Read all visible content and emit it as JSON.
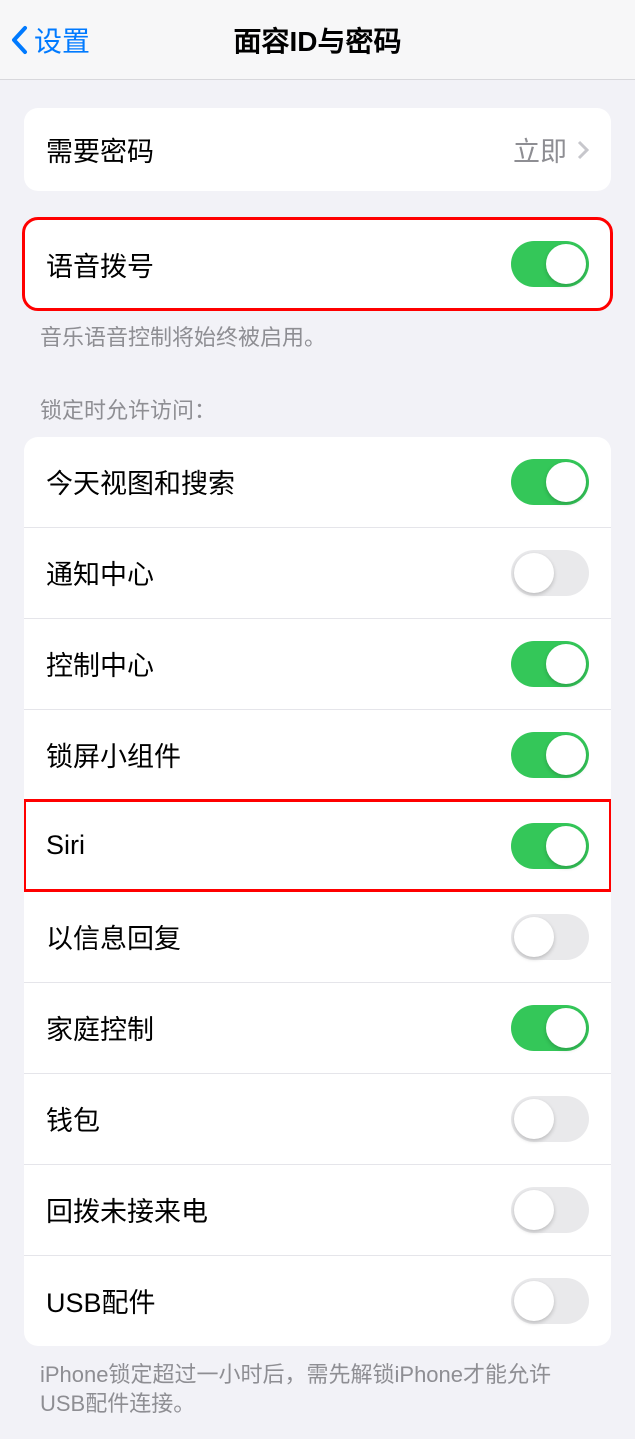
{
  "header": {
    "back_label": "设置",
    "title": "面容ID与密码"
  },
  "require_passcode": {
    "label": "需要密码",
    "value": "立即"
  },
  "voice_dial": {
    "label": "语音拨号",
    "enabled": true,
    "footer": "音乐语音控制将始终被启用。"
  },
  "lock_access_section": {
    "header": "锁定时允许访问：",
    "items": [
      {
        "label": "今天视图和搜索",
        "enabled": true
      },
      {
        "label": "通知中心",
        "enabled": false
      },
      {
        "label": "控制中心",
        "enabled": true
      },
      {
        "label": "锁屏小组件",
        "enabled": true
      },
      {
        "label": "Siri",
        "enabled": true
      },
      {
        "label": "以信息回复",
        "enabled": false
      },
      {
        "label": "家庭控制",
        "enabled": true
      },
      {
        "label": "钱包",
        "enabled": false
      },
      {
        "label": "回拨未接来电",
        "enabled": false
      },
      {
        "label": "USB配件",
        "enabled": false
      }
    ],
    "footer": "iPhone锁定超过一小时后，需先解锁iPhone才能允许USB配件连接。"
  },
  "highlights": {
    "voice_dial_group": true,
    "siri_row_index": 4
  }
}
